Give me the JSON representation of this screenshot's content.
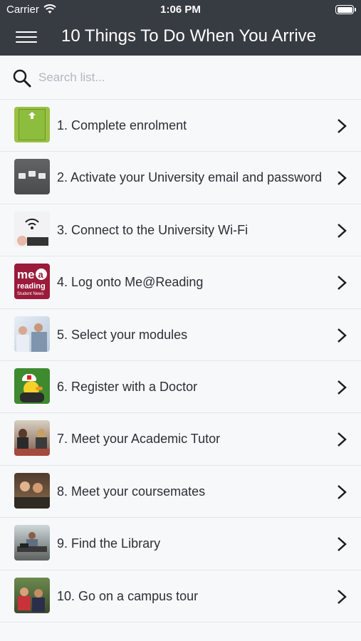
{
  "status": {
    "carrier": "Carrier",
    "time": "1:06 PM"
  },
  "header": {
    "title": "10 Things To Do When You Arrive"
  },
  "search": {
    "placeholder": "Search list..."
  },
  "items": [
    {
      "label": "1. Complete enrolment",
      "thumb": "enrolment-sign-thumbnail"
    },
    {
      "label": "2. Activate your University email and password",
      "thumb": "keyboard-thumbnail"
    },
    {
      "label": "3. Connect to the University Wi-Fi",
      "thumb": "wifi-thumbnail"
    },
    {
      "label": "4. Log onto Me@Reading",
      "thumb": "me-at-reading-logo-thumbnail",
      "logo_text": [
        "me",
        "reading",
        "Student News"
      ]
    },
    {
      "label": "5. Select your modules",
      "thumb": "students-thumbnail"
    },
    {
      "label": "6. Register with a Doctor",
      "thumb": "doctor-duck-thumbnail"
    },
    {
      "label": "7. Meet your Academic Tutor",
      "thumb": "tutor-meeting-thumbnail"
    },
    {
      "label": "8. Meet your coursemates",
      "thumb": "coursemates-thumbnail"
    },
    {
      "label": "9. Find the Library",
      "thumb": "library-thumbnail"
    },
    {
      "label": "10. Go on a campus tour",
      "thumb": "campus-tour-thumbnail"
    }
  ]
}
